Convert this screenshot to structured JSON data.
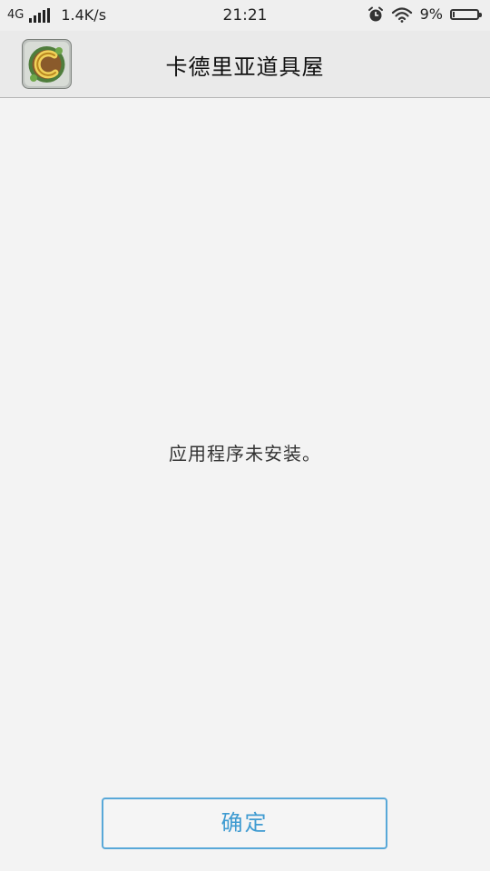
{
  "status_bar": {
    "network": "4G",
    "speed": "1.4K/s",
    "time": "21:21",
    "battery": "9%",
    "battery_level": 0.09,
    "icons": [
      "signal-bars-icon",
      "alarm-icon",
      "wifi-icon",
      "battery-icon"
    ]
  },
  "header": {
    "app_icon": "app-icon",
    "title": "卡德里亚道具屋"
  },
  "dialog": {
    "message": "应用程序未安装。",
    "confirm_label": "确定"
  },
  "colors": {
    "background": "#f3f3f3",
    "accent": "#3f9bd1"
  }
}
